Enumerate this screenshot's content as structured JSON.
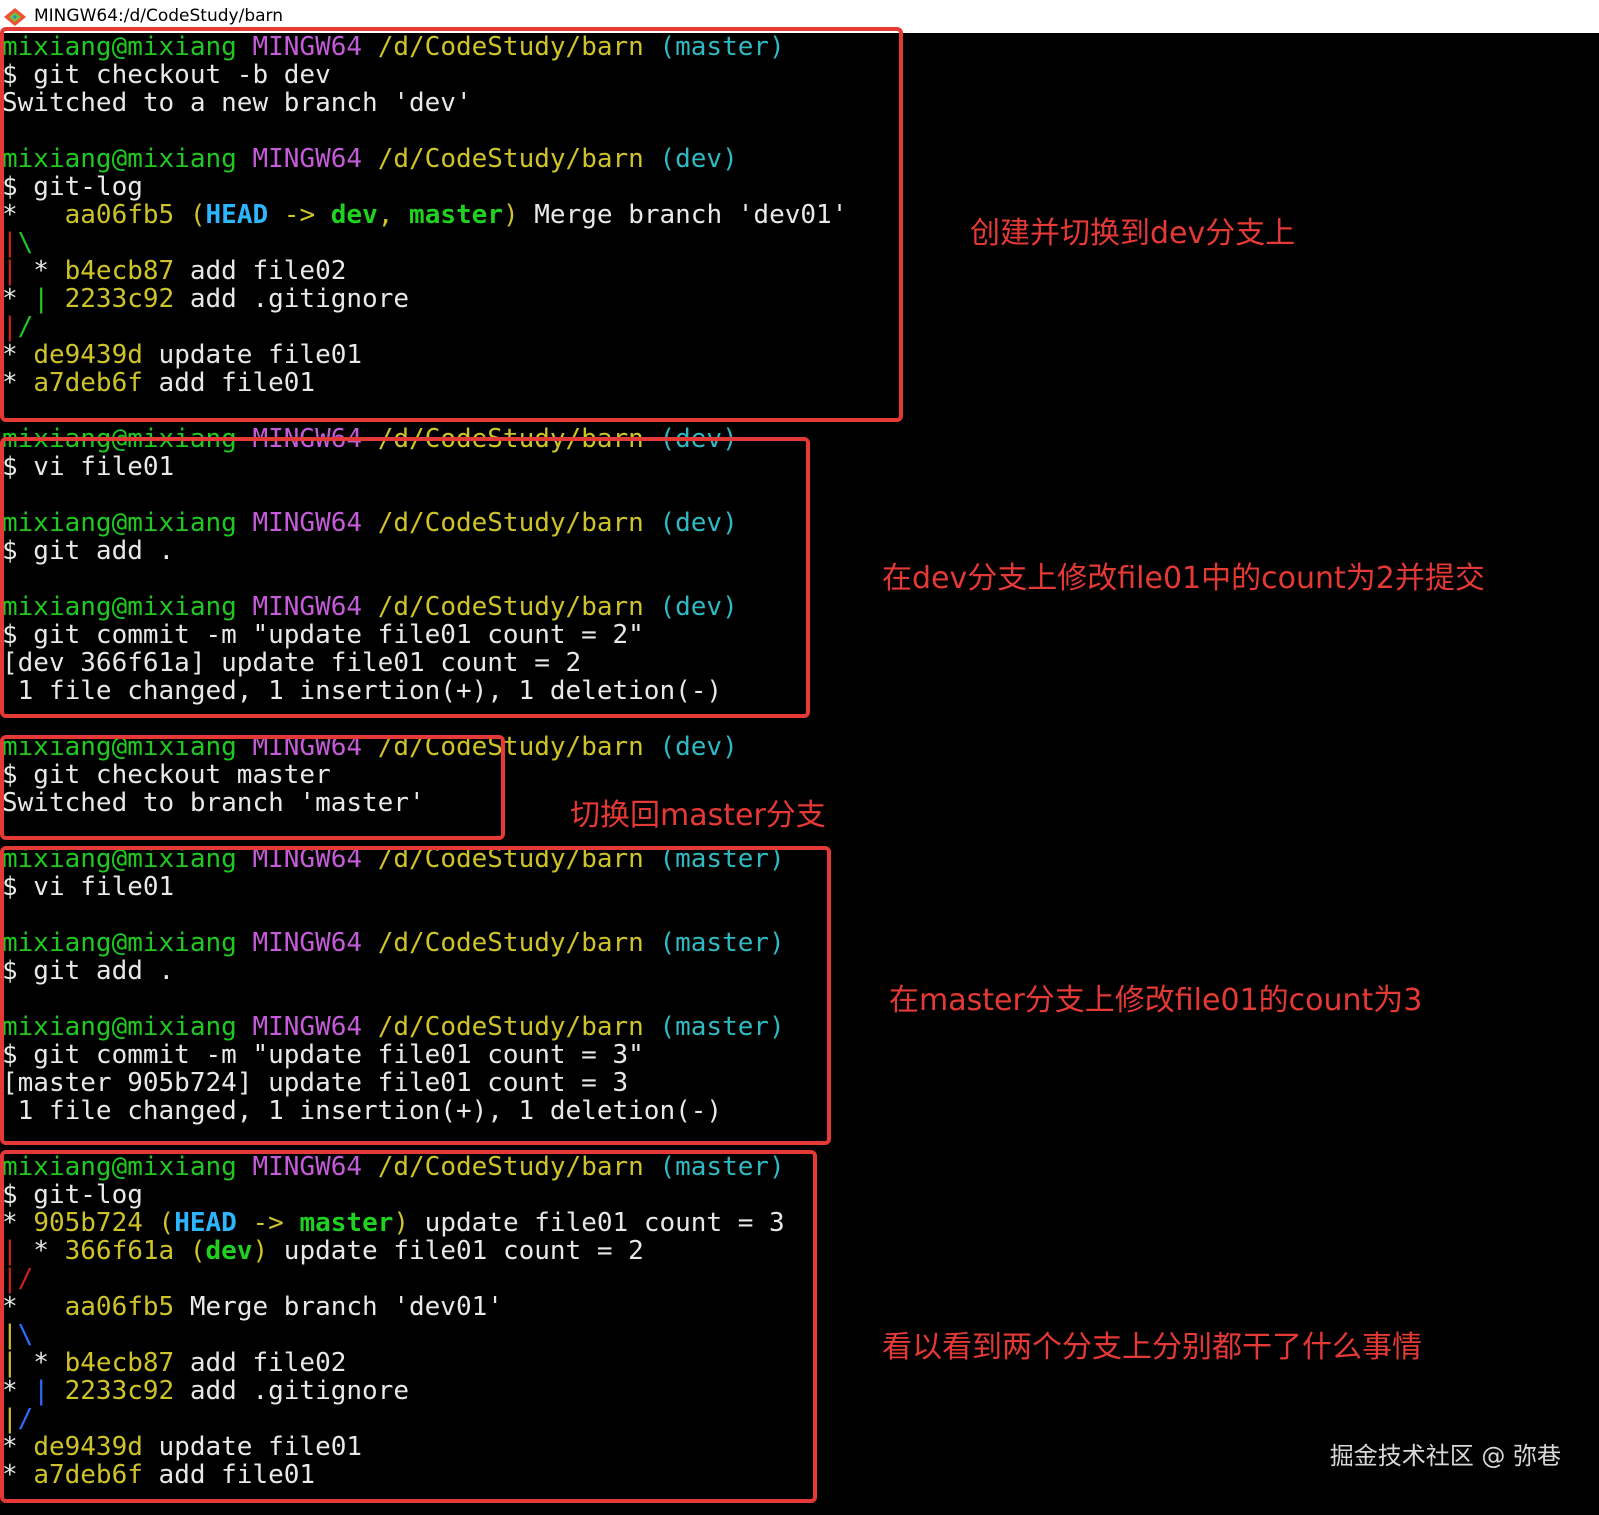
{
  "window": {
    "title": "MINGW64:/d/CodeStudy/barn"
  },
  "prompt": {
    "user": "mixiang@mixiang",
    "host": "MINGW64",
    "path": "/d/CodeStudy/barn",
    "branch_master": "(master)",
    "branch_dev": "(dev)"
  },
  "terminal": {
    "cmd_checkout_dev": "$ git checkout -b dev",
    "out_new_branch": "Switched to a new branch 'dev'",
    "cmd_gitlog": "$ git-log",
    "log1": {
      "merge_hash": "aa06fb5",
      "merge_head": "HEAD",
      "merge_arrow": " -> ",
      "merge_dev": "dev",
      "merge_sep": ", ",
      "merge_master": "master",
      "merge_msg": " Merge branch 'dev01'",
      "b4_hash": "b4ecb87",
      "b4_msg": " add file02",
      "gi_hash": "2233c92",
      "gi_msg": " add .gitignore",
      "de_hash": "de9439d",
      "de_msg": " update file01",
      "a7_hash": "a7deb6f",
      "a7_msg": " add file01"
    },
    "cmd_vi": "$ vi file01",
    "cmd_add": "$ git add .",
    "cmd_commit_2": "$ git commit -m \"update file01 count = 2\"",
    "out_commit_2": "[dev 366f61a] update file01 count = 2",
    "out_changed": " 1 file changed, 1 insertion(+), 1 deletion(-)",
    "cmd_checkout_master": "$ git checkout master",
    "out_switched_master": "Switched to branch 'master'",
    "cmd_commit_3": "$ git commit -m \"update file01 count = 3\"",
    "out_commit_3": "[master 905b724] update file01 count = 3",
    "log2": {
      "c905_hash": "905b724",
      "c905_head": "HEAD",
      "c905_arrow": " -> ",
      "c905_master": "master",
      "c905_msg": " update file01 count = 3",
      "c366_hash": "366f61a",
      "c366_dev": "dev",
      "c366_msg": " update file01 count = 2",
      "merge_hash": "aa06fb5",
      "merge_msg": " Merge branch 'dev01'"
    }
  },
  "annotations": {
    "note1": "创建并切换到dev分支上",
    "note2": "在dev分支上修改file01中的count为2并提交",
    "note3": "切换回master分支",
    "note4": "在master分支上修改file01的count为3",
    "note5": "看以看到两个分支上分别都干了什么事情"
  },
  "watermark": "掘金技术社区 @ 弥巷",
  "colors": {
    "annotation_red": "#e53935",
    "prompt_user": "#1fc91f",
    "prompt_host": "#c45bd8",
    "prompt_path": "#cfc32a",
    "prompt_branch": "#2fb9c2"
  },
  "icons": {
    "app_icon": "git-bash-icon"
  }
}
